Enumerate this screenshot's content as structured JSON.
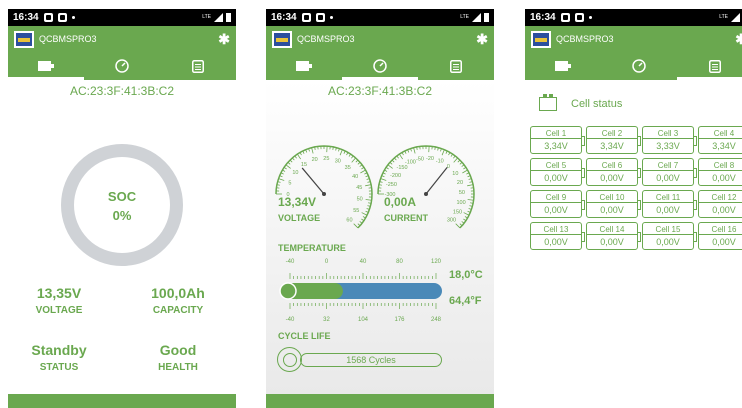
{
  "status_bar": {
    "time": "16:34",
    "network": "LTE"
  },
  "app": {
    "title": "QCBMSPRO3"
  },
  "tabs": [
    "battery",
    "gauge",
    "list"
  ],
  "screen1": {
    "mac": "AC:23:3F:41:3B:C2",
    "soc_label": "SOC",
    "soc_value": "0%",
    "soc_fraction": 0,
    "voltage": {
      "value": "13,35V",
      "label": "VOLTAGE"
    },
    "capacity": {
      "value": "100,0Ah",
      "label": "CAPACITY"
    },
    "status": {
      "value": "Standby",
      "label": "STATUS"
    },
    "health": {
      "value": "Good",
      "label": "HEALTH"
    }
  },
  "screen2": {
    "mac": "AC:23:3F:41:3B:C2",
    "voltage": {
      "value": "13,34V",
      "label": "VOLTAGE",
      "ticks": [
        "0",
        "5",
        "10",
        "15",
        "20",
        "25",
        "30",
        "35",
        "40",
        "45",
        "50",
        "55",
        "60"
      ]
    },
    "current": {
      "value": "0,00A",
      "label": "CURRENT",
      "ticks": [
        "-300",
        "-250",
        "-200",
        "-150",
        "-100",
        "-50",
        "-20",
        "-10",
        "0",
        "10",
        "20",
        "50",
        "100",
        "150",
        "300"
      ]
    },
    "temperature": {
      "label": "TEMPERATURE",
      "celsius": "18,0°C",
      "fahrenheit": "64,4°F",
      "c_ticks": [
        "-40",
        "0",
        "40",
        "80",
        "120"
      ],
      "f_ticks": [
        "-40",
        "32",
        "104",
        "176",
        "248"
      ]
    },
    "cycle_life": {
      "label": "CYCLE LIFE",
      "value": "1568 Cycles"
    }
  },
  "screen3": {
    "title": "Cell status",
    "cells": [
      {
        "name": "Cell 1",
        "voltage": "3,34V"
      },
      {
        "name": "Cell 2",
        "voltage": "3,34V"
      },
      {
        "name": "Cell 3",
        "voltage": "3,33V"
      },
      {
        "name": "Cell 4",
        "voltage": "3,34V"
      },
      {
        "name": "Cell 5",
        "voltage": "0,00V"
      },
      {
        "name": "Cell 6",
        "voltage": "0,00V"
      },
      {
        "name": "Cell 7",
        "voltage": "0,00V"
      },
      {
        "name": "Cell 8",
        "voltage": "0,00V"
      },
      {
        "name": "Cell 9",
        "voltage": "0,00V"
      },
      {
        "name": "Cell 10",
        "voltage": "0,00V"
      },
      {
        "name": "Cell 11",
        "voltage": "0,00V"
      },
      {
        "name": "Cell 12",
        "voltage": "0,00V"
      },
      {
        "name": "Cell 13",
        "voltage": "0,00V"
      },
      {
        "name": "Cell 14",
        "voltage": "0,00V"
      },
      {
        "name": "Cell 15",
        "voltage": "0,00V"
      },
      {
        "name": "Cell 16",
        "voltage": "0,00V"
      }
    ]
  },
  "colors": {
    "accent": "#6aa84f",
    "ring": "#cfd2d6",
    "thermo": "#4a89b8"
  }
}
